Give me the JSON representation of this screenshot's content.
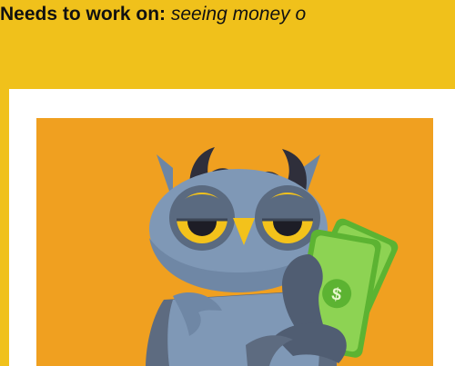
{
  "caption": {
    "label": "Needs to work on:",
    "value": "seeing money o"
  },
  "illustration": {
    "icon": "owl-holding-money-icon",
    "money_symbol": "$",
    "colors": {
      "background": "#f0c11b",
      "card": "#ffffff",
      "art_background": "#f0a020",
      "owl_body": "#7f98b6",
      "owl_dark": "#505d72",
      "eye_yellow": "#f3c21b",
      "money_green": "#8dd353"
    }
  }
}
